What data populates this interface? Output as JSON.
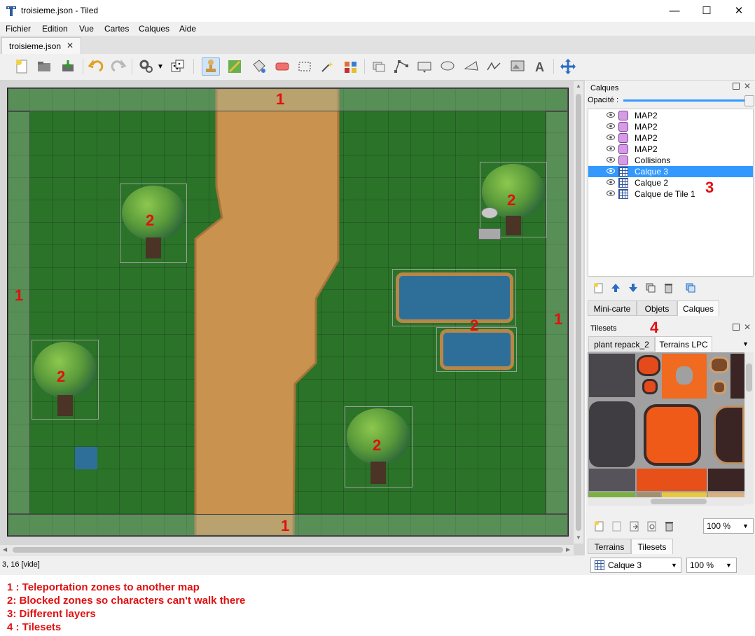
{
  "window": {
    "title": "troisieme.json - Tiled",
    "minimize": "—",
    "maximize": "☐",
    "close": "✕"
  },
  "menu": [
    "Fichier",
    "Edition",
    "Vue",
    "Cartes",
    "Calques",
    "Aide"
  ],
  "document_tab": {
    "label": "troisieme.json",
    "close": "✕"
  },
  "map": {
    "annotations": [
      "1",
      "1",
      "1",
      "1",
      "2",
      "2",
      "2",
      "2",
      "2"
    ]
  },
  "layers_panel": {
    "title": "Calques",
    "opacity_label": "Opacité :",
    "layers": [
      {
        "name": "MAP2",
        "type": "object"
      },
      {
        "name": "MAP2",
        "type": "object"
      },
      {
        "name": "MAP2",
        "type": "object"
      },
      {
        "name": "MAP2",
        "type": "object"
      },
      {
        "name": "Collisions",
        "type": "object"
      },
      {
        "name": "Calque 3",
        "type": "tile",
        "selected": true
      },
      {
        "name": "Calque 2",
        "type": "tile"
      },
      {
        "name": "Calque de Tile 1",
        "type": "tile"
      }
    ],
    "annotation": "3",
    "tabs": [
      "Mini-carte",
      "Objets",
      "Calques"
    ],
    "active_tab": "Calques"
  },
  "tilesets_panel": {
    "title": "Tilesets",
    "annotation": "4",
    "tabs": [
      "plant repack_2",
      "Terrains LPC"
    ],
    "active_tab": "Terrains LPC",
    "zoom": "100 %",
    "bottom_tabs": [
      "Terrains",
      "Tilesets"
    ],
    "active_bottom_tab": "Tilesets"
  },
  "status": {
    "coords": "3, 16 [vide]",
    "layer_select": "Calque 3",
    "zoom": "100 %"
  },
  "notes": [
    "1 : Teleportation zones to another map",
    "2: Blocked zones so characters can't walk there",
    "3: Different layers",
    "4 : Tilesets"
  ],
  "colors": {
    "accent": "#3399ff",
    "annotation": "#e01010",
    "grass": "#2b7329",
    "path": "#c9924f",
    "water": "#2e6f9a"
  }
}
